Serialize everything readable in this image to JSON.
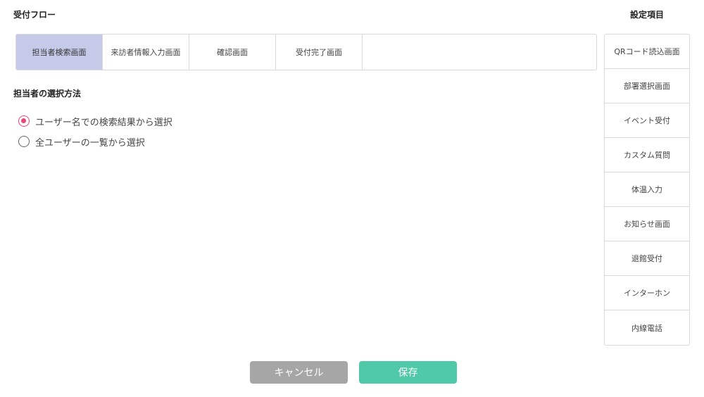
{
  "header": {
    "flow_title": "受付フロー",
    "settings_title": "設定項目"
  },
  "tabs": [
    {
      "label": "担当者検索画面",
      "active": true
    },
    {
      "label": "来訪者情報入力画面",
      "active": false
    },
    {
      "label": "確認画面",
      "active": false
    },
    {
      "label": "受付完了画面",
      "active": false
    }
  ],
  "method": {
    "title": "担当者の選択方法",
    "options": [
      {
        "label": "ユーザー名での検索結果から選択",
        "checked": true
      },
      {
        "label": "全ユーザーの一覧から選択",
        "checked": false
      }
    ]
  },
  "settings": {
    "items": [
      "QRコード読込画面",
      "部署選択画面",
      "イベント受付",
      "カスタム質問",
      "体温入力",
      "お知らせ画面",
      "退館受付",
      "インターホン",
      "内線電話"
    ]
  },
  "actions": {
    "cancel_label": "キャンセル",
    "save_label": "保存"
  },
  "colors": {
    "active_tab": "#c5cae9",
    "radio_accent": "#e8477a",
    "cancel_button": "#a6a6a6",
    "save_button": "#4fc9a8"
  }
}
